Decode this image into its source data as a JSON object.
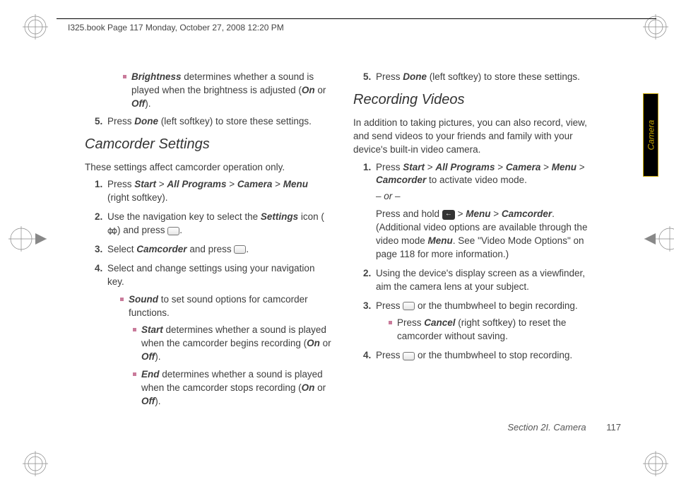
{
  "header": {
    "crop_text": "I325.book  Page 117  Monday, October 27, 2008  12:20 PM"
  },
  "sidetab": {
    "label": "Camera"
  },
  "left": {
    "brightness_item": "determines whether a sound is played when the brightness is adjusted (",
    "brightness_bold": "Brightness",
    "on": "On",
    "off": "Off",
    "or": " or ",
    "close_paren": ").",
    "step5_num": "5.",
    "step5_a": "Press ",
    "step5_done": "Done",
    "step5_b": " (left softkey) to store these settings.",
    "h2": "Camcorder Settings",
    "intro": "These settings affect camcorder operation only.",
    "s1_num": "1.",
    "s1_a": "Press ",
    "s1_start": "Start",
    "gt": " > ",
    "s1_all": "All Programs",
    "s1_cam": "Camera",
    "s1_menu": "Menu",
    "s1_b": " (right softkey).",
    "s2_num": "2.",
    "s2_a": "Use the navigation key to select the ",
    "s2_settings": "Settings",
    "s2_b": " icon (",
    "s2_c": ") and press ",
    "s2_d": ".",
    "s3_num": "3.",
    "s3_a": "Select ",
    "s3_cam": "Camcorder",
    "s3_b": " and press ",
    "s3_c": ".",
    "s4_num": "4.",
    "s4_a": "Select and change settings using your navigation key.",
    "sound_bold": "Sound",
    "sound_txt": " to set sound options for camcorder functions.",
    "start_bold": "Start",
    "start_txt": " determines whether a sound is played when the camcorder begins recording (",
    "end_bold": "End",
    "end_txt": " determines whether a sound is played when the camcorder stops recording (",
    "onoff_close": ")."
  },
  "right": {
    "s5_num": "5.",
    "s5_a": "Press ",
    "s5_done": "Done",
    "s5_b": " (left softkey) to store these settings.",
    "h2": "Recording Videos",
    "intro": "In addition to taking pictures, you can also record, view, and send videos to your friends and family with your device's built-in video camera.",
    "r1_num": "1.",
    "r1_a": "Press ",
    "r1_start": "Start",
    "gt": " > ",
    "r1_all": "All Programs",
    "r1_cam": "Camera",
    "r1_menu": "Menu",
    "r1_camc": "Camcorder",
    "r1_b": " to activate video mode.",
    "orsep": "– or –",
    "r1_c": "Press and hold ",
    "r1_d": ". (Additional video options are available through the video mode ",
    "r1_menu2": "Menu",
    "r1_e": ". See \"Video Mode Options\" on page 118 for more information.)",
    "r2_num": "2.",
    "r2_a": "Using the device's display screen as a viewfinder, aim the camera lens at your subject.",
    "r3_num": "3.",
    "r3_a": "Press ",
    "r3_b": " or the thumbwheel to begin recording.",
    "r3_cancel": "Cancel",
    "r3_c": " (right softkey) to reset the camcorder without saving.",
    "r3_press": "Press ",
    "r4_num": "4.",
    "r4_a": "Press ",
    "r4_b": " or the thumbwheel to stop recording."
  },
  "footer": {
    "section": "Section 2I. Camera",
    "page": "117"
  }
}
